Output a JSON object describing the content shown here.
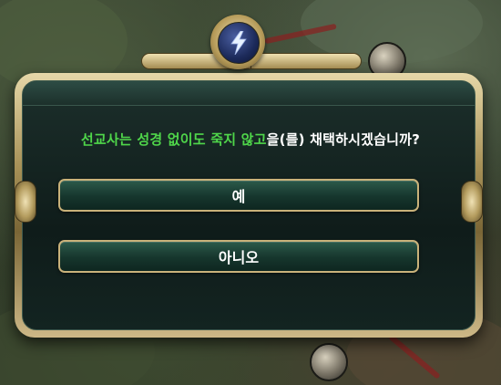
{
  "dialog": {
    "prompt_highlight": "선교사는 성경 없이도 죽지 않고",
    "prompt_rest": "을(를) 채택하시겠습니까?",
    "yes_label": "예",
    "no_label": "아니오"
  },
  "icons": {
    "crest": "lightning-bolt-icon"
  },
  "colors": {
    "highlight": "#4fd64a",
    "button_fill": "#16362d",
    "button_border": "#c9b27a",
    "panel": "#0f1c1a",
    "frame_gold": "#a89258"
  }
}
